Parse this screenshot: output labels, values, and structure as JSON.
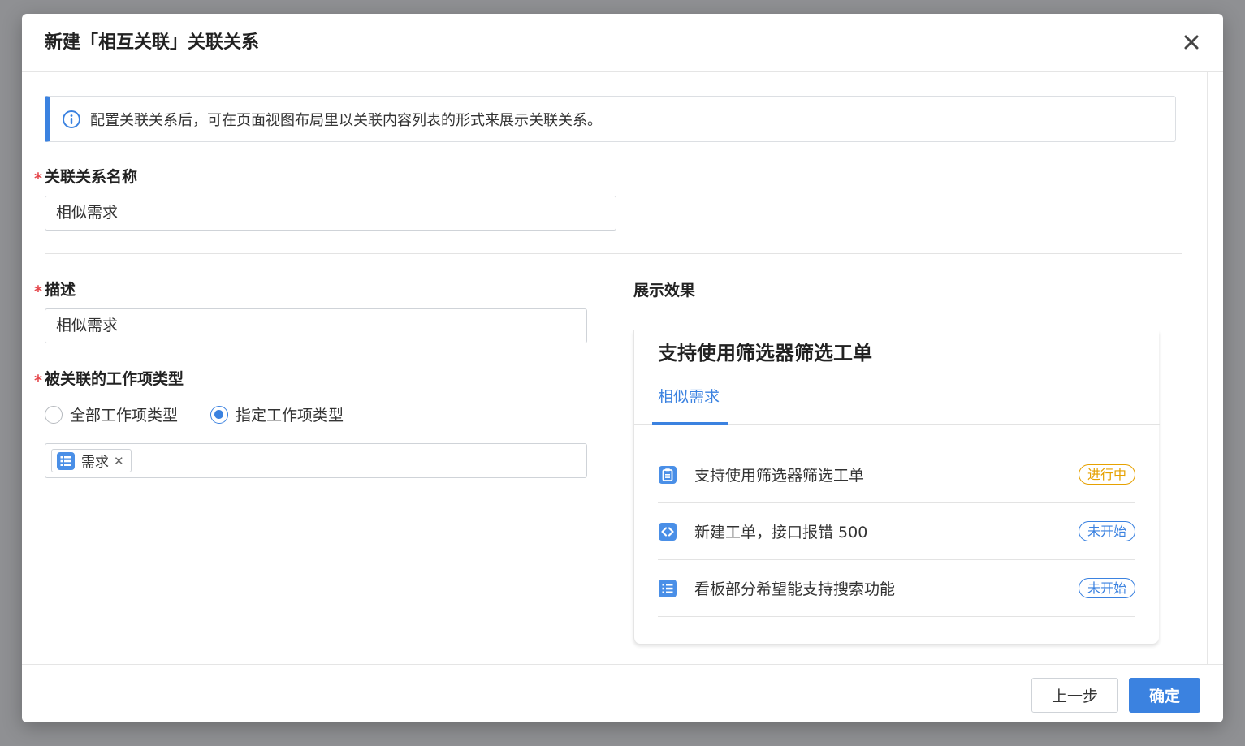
{
  "dialog": {
    "title": "新建「相互关联」关联关系",
    "info_text": "配置关联关系后，可在页面视图布局里以关联内容列表的形式来展示关联关系。"
  },
  "form": {
    "name_label": "关联关系名称",
    "name_value": "相似需求",
    "desc_label": "描述",
    "desc_value": "相似需求",
    "type_label": "被关联的工作项类型",
    "radio_all": "全部工作项类型",
    "radio_specific": "指定工作项类型",
    "selected_radio": "specific",
    "tags": [
      {
        "label": "需求",
        "icon": "list-icon"
      }
    ]
  },
  "preview": {
    "label": "展示效果",
    "title": "支持使用筛选器筛选工单",
    "tab": "相似需求",
    "rows": [
      {
        "icon": "clipboard-icon",
        "text": "支持使用筛选器筛选工单",
        "status": "进行中",
        "status_color": "#e6a100"
      },
      {
        "icon": "code-icon",
        "text": "新建工单，接口报错 500",
        "status": "未开始",
        "status_color": "#3b82e0"
      },
      {
        "icon": "list-icon",
        "text": "看板部分希望能支持搜索功能",
        "status": "未开始",
        "status_color": "#3b82e0"
      }
    ]
  },
  "footer": {
    "prev_label": "上一步",
    "ok_label": "确定"
  },
  "colors": {
    "accent": "#3b82e0",
    "required": "#e5484d",
    "in_progress": "#e6a100"
  }
}
